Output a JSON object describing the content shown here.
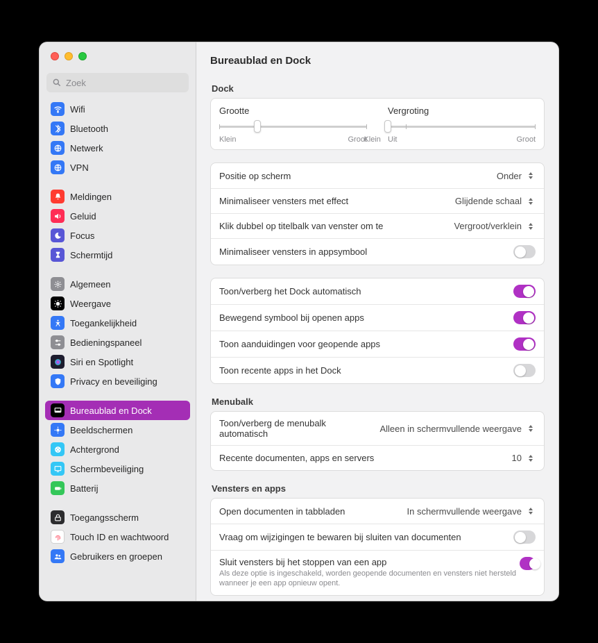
{
  "window": {
    "title": "Bureaublad en Dock"
  },
  "search": {
    "placeholder": "Zoek"
  },
  "sidebar": {
    "groups": [
      [
        {
          "label": "Wifi",
          "bg": "#3478f6"
        },
        {
          "label": "Bluetooth",
          "bg": "#3478f6"
        },
        {
          "label": "Netwerk",
          "bg": "#3478f6"
        },
        {
          "label": "VPN",
          "bg": "#3478f6"
        }
      ],
      [
        {
          "label": "Meldingen",
          "bg": "#ff3b30"
        },
        {
          "label": "Geluid",
          "bg": "#ff2d55"
        },
        {
          "label": "Focus",
          "bg": "#5856d6"
        },
        {
          "label": "Schermtijd",
          "bg": "#5856d6"
        }
      ],
      [
        {
          "label": "Algemeen",
          "bg": "#8e8e93"
        },
        {
          "label": "Weergave",
          "bg": "#000000"
        },
        {
          "label": "Toegankelijkheid",
          "bg": "#3478f6"
        },
        {
          "label": "Bedieningspaneel",
          "bg": "#8e8e93"
        },
        {
          "label": "Siri en Spotlight",
          "bg": "#1d1c2e"
        },
        {
          "label": "Privacy en beveiliging",
          "bg": "#3478f6"
        }
      ],
      [
        {
          "label": "Bureaublad en Dock",
          "bg": "#000000",
          "selected": true
        },
        {
          "label": "Beeldschermen",
          "bg": "#3478f6"
        },
        {
          "label": "Achtergrond",
          "bg": "#34c7f6"
        },
        {
          "label": "Schermbeveiliging",
          "bg": "#34c7f6"
        },
        {
          "label": "Batterij",
          "bg": "#34c759"
        }
      ],
      [
        {
          "label": "Toegangsscherm",
          "bg": "#2c2c2e"
        },
        {
          "label": "Touch ID en wachtwoord",
          "bg": "#ffffff",
          "fg": "#ff6a7c",
          "border": "#d0d0d0"
        },
        {
          "label": "Gebruikers en groepen",
          "bg": "#3478f6"
        }
      ]
    ]
  },
  "sections": {
    "dock": {
      "title": "Dock",
      "size": {
        "label": "Grootte",
        "min": "Klein",
        "max": "Groot",
        "value_pct": 26
      },
      "mag": {
        "label": "Vergroting",
        "off": "Uit",
        "min": "Klein",
        "max": "Groot",
        "value_pct": 0
      },
      "rows": {
        "position": {
          "label": "Positie op scherm",
          "value": "Onder"
        },
        "min_effect": {
          "label": "Minimaliseer vensters met effect",
          "value": "Glijdende schaal"
        },
        "dbl_title": {
          "label": "Klik dubbel op titelbalk van venster om te",
          "value": "Vergroot/verklein"
        },
        "min_app": {
          "label": "Minimaliseer vensters in appsymbool",
          "on": false
        },
        "autohide": {
          "label": "Toon/verberg het Dock automatisch",
          "on": true
        },
        "bounce": {
          "label": "Bewegend symbool bij openen apps",
          "on": true
        },
        "indicators": {
          "label": "Toon aanduidingen voor geopende apps",
          "on": true
        },
        "recent": {
          "label": "Toon recente apps in het Dock",
          "on": false
        }
      }
    },
    "menubar": {
      "title": "Menubalk",
      "rows": {
        "autohide": {
          "label": "Toon/verberg de menubalk automatisch",
          "value": "Alleen in schermvullende weergave"
        },
        "recent": {
          "label": "Recente documenten, apps en servers",
          "value": "10"
        }
      }
    },
    "windows": {
      "title": "Vensters en apps",
      "rows": {
        "open_tabs": {
          "label": "Open documenten in tabbladen",
          "value": "In schermvullende weergave"
        },
        "ask_save": {
          "label": "Vraag om wijzigingen te bewaren bij sluiten van documenten",
          "on": false
        },
        "close_win": {
          "label": "Sluit vensters bij het stoppen van een app",
          "sub": "Als deze optie is ingeschakeld, worden geopende documenten en vensters niet hersteld wanneer je een app opnieuw opent.",
          "on": true
        }
      }
    }
  }
}
